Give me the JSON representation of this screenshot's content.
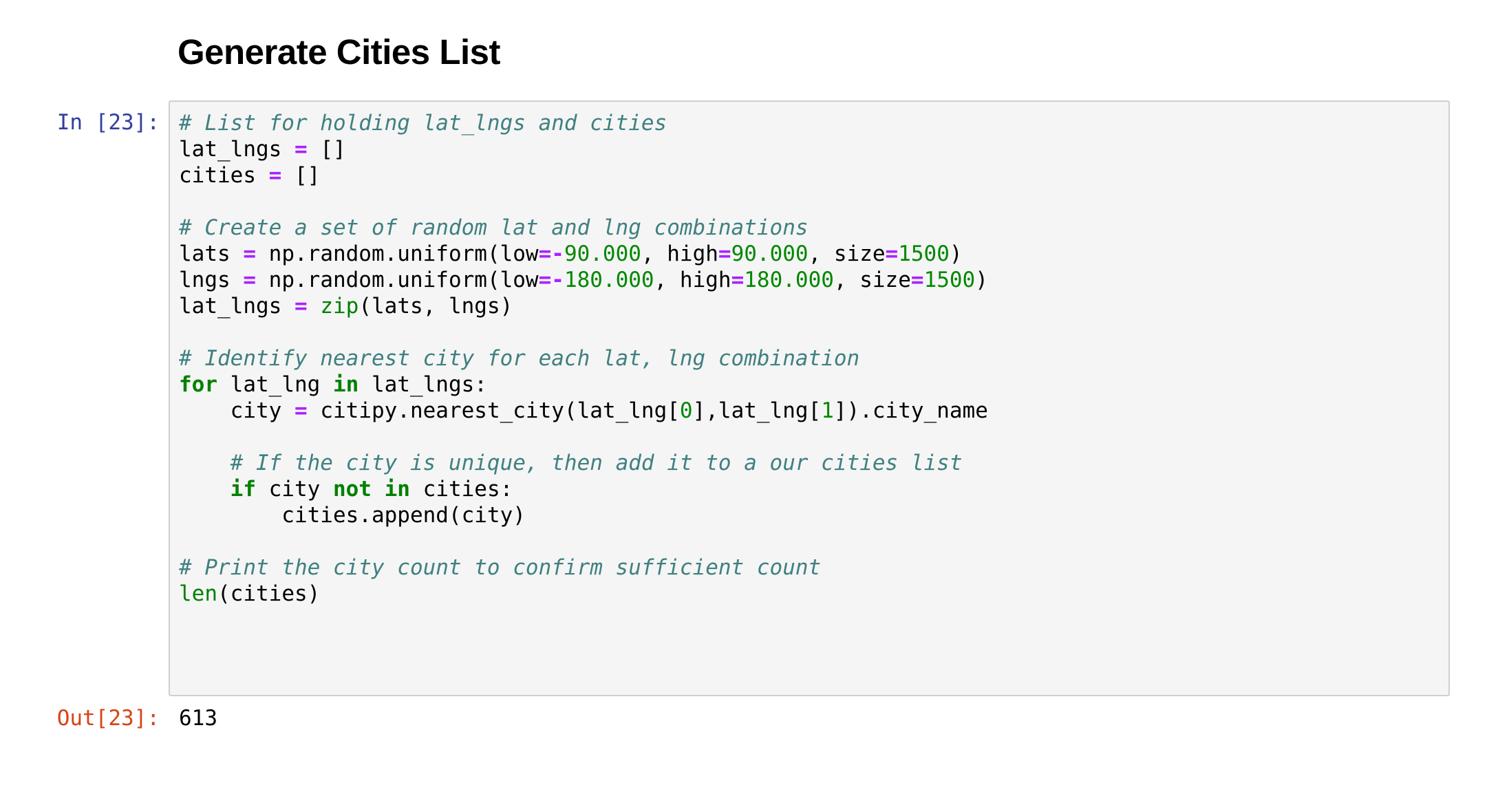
{
  "heading": "Generate Cities List",
  "input_prompt": "In [23]:",
  "output_prompt": "Out[23]:",
  "output_value": "613",
  "code_lines": [
    [
      {
        "t": "c",
        "s": "# List for holding lat_lngs and cities"
      }
    ],
    [
      {
        "t": "",
        "s": "lat_lngs "
      },
      {
        "t": "o",
        "s": "="
      },
      {
        "t": "",
        "s": " []"
      }
    ],
    [
      {
        "t": "",
        "s": "cities "
      },
      {
        "t": "o",
        "s": "="
      },
      {
        "t": "",
        "s": " []"
      }
    ],
    [],
    [
      {
        "t": "c",
        "s": "# Create a set of random lat and lng combinations"
      }
    ],
    [
      {
        "t": "",
        "s": "lats "
      },
      {
        "t": "o",
        "s": "="
      },
      {
        "t": "",
        "s": " np.random.uniform(low"
      },
      {
        "t": "o",
        "s": "=-"
      },
      {
        "t": "n",
        "s": "90.000"
      },
      {
        "t": "",
        "s": ", high"
      },
      {
        "t": "o",
        "s": "="
      },
      {
        "t": "n",
        "s": "90.000"
      },
      {
        "t": "",
        "s": ", size"
      },
      {
        "t": "o",
        "s": "="
      },
      {
        "t": "n",
        "s": "1500"
      },
      {
        "t": "",
        "s": ")"
      }
    ],
    [
      {
        "t": "",
        "s": "lngs "
      },
      {
        "t": "o",
        "s": "="
      },
      {
        "t": "",
        "s": " np.random.uniform(low"
      },
      {
        "t": "o",
        "s": "=-"
      },
      {
        "t": "n",
        "s": "180.000"
      },
      {
        "t": "",
        "s": ", high"
      },
      {
        "t": "o",
        "s": "="
      },
      {
        "t": "n",
        "s": "180.000"
      },
      {
        "t": "",
        "s": ", size"
      },
      {
        "t": "o",
        "s": "="
      },
      {
        "t": "n",
        "s": "1500"
      },
      {
        "t": "",
        "s": ")"
      }
    ],
    [
      {
        "t": "",
        "s": "lat_lngs "
      },
      {
        "t": "o",
        "s": "="
      },
      {
        "t": "",
        "s": " "
      },
      {
        "t": "b",
        "s": "zip"
      },
      {
        "t": "",
        "s": "(lats, lngs)"
      }
    ],
    [],
    [
      {
        "t": "c",
        "s": "# Identify nearest city for each lat, lng combination"
      }
    ],
    [
      {
        "t": "k",
        "s": "for"
      },
      {
        "t": "",
        "s": " lat_lng "
      },
      {
        "t": "k",
        "s": "in"
      },
      {
        "t": "",
        "s": " lat_lngs:"
      }
    ],
    [
      {
        "t": "",
        "s": "    city "
      },
      {
        "t": "o",
        "s": "="
      },
      {
        "t": "",
        "s": " citipy.nearest_city(lat_lng["
      },
      {
        "t": "n",
        "s": "0"
      },
      {
        "t": "",
        "s": "],lat_lng["
      },
      {
        "t": "n",
        "s": "1"
      },
      {
        "t": "",
        "s": "]).city_name"
      }
    ],
    [],
    [
      {
        "t": "",
        "s": "    "
      },
      {
        "t": "c",
        "s": "# If the city is unique, then add it to a our cities list"
      }
    ],
    [
      {
        "t": "",
        "s": "    "
      },
      {
        "t": "k",
        "s": "if"
      },
      {
        "t": "",
        "s": " city "
      },
      {
        "t": "k",
        "s": "not"
      },
      {
        "t": "",
        "s": " "
      },
      {
        "t": "k",
        "s": "in"
      },
      {
        "t": "",
        "s": " cities:"
      }
    ],
    [
      {
        "t": "",
        "s": "        cities.append(city)"
      }
    ],
    [],
    [
      {
        "t": "c",
        "s": "# Print the city count to confirm sufficient count"
      }
    ],
    [
      {
        "t": "b",
        "s": "len"
      },
      {
        "t": "",
        "s": "(cities)"
      }
    ]
  ]
}
